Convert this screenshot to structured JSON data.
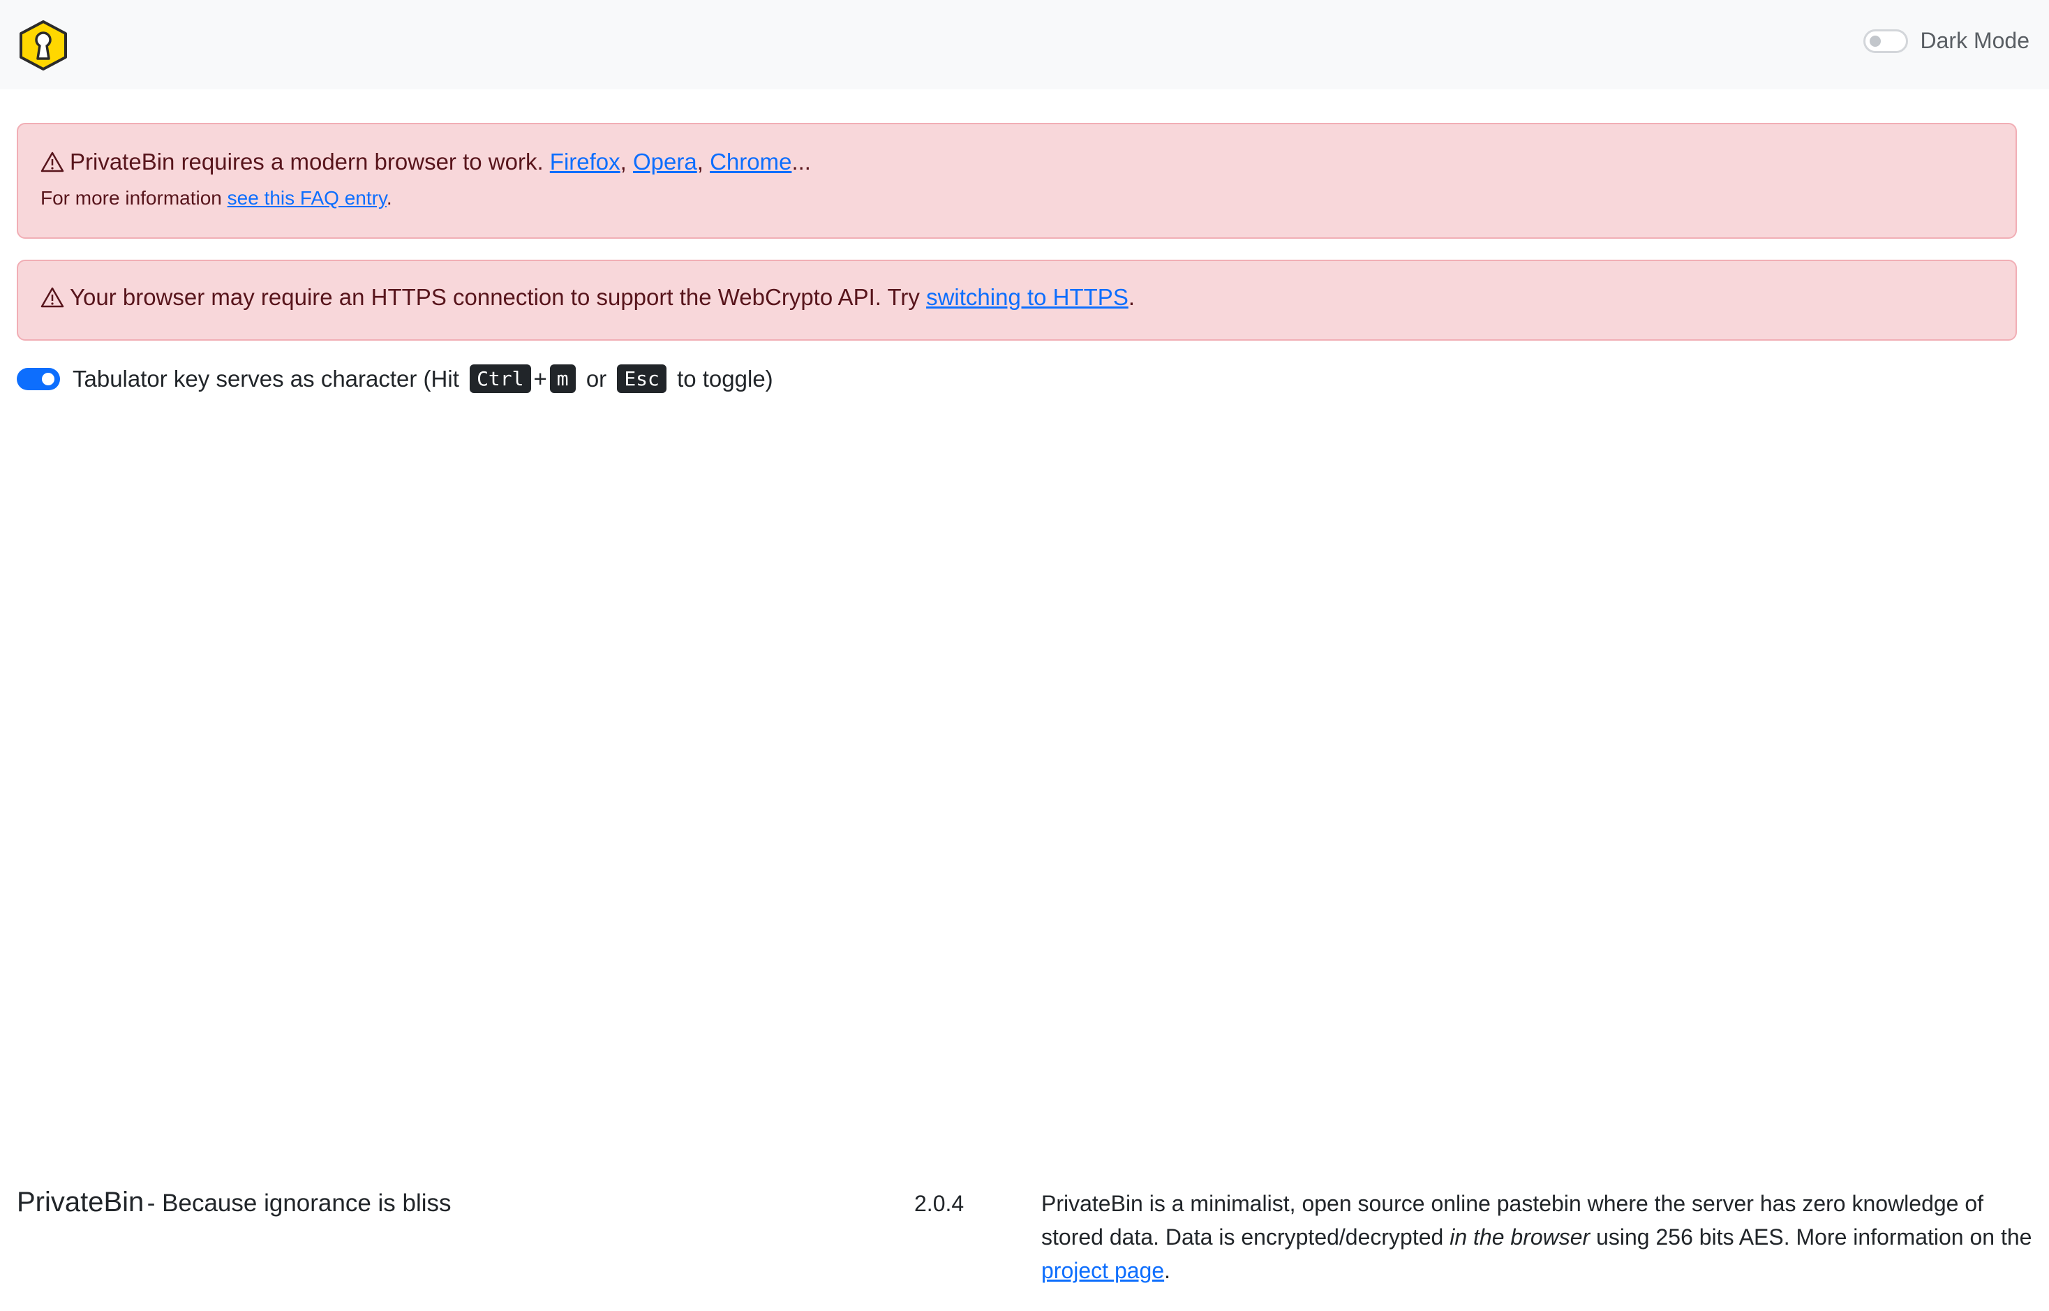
{
  "navbar": {
    "logo_icon": "keyhole-hexagon-icon",
    "dark_mode_label": "Dark Mode",
    "dark_mode_enabled": false
  },
  "alerts": {
    "modern_browser": {
      "icon": "warning-triangle-icon",
      "text": "PrivateBin requires a modern browser to work.",
      "links": [
        "Firefox",
        "Opera",
        "Chrome"
      ],
      "sep1": ",",
      "sep2": ",",
      "ellipsis": "...",
      "more_info_prefix": "For more information",
      "faq_link": "see this FAQ entry",
      "period": "."
    },
    "https": {
      "icon": "warning-triangle-icon",
      "text": "Your browser may require an HTTPS connection to support the WebCrypto API. Try",
      "link": "switching to HTTPS",
      "period": "."
    }
  },
  "tab_toggle": {
    "enabled": true,
    "prefix": "Tabulator key serves as character (Hit",
    "key1": "Ctrl",
    "plus": "+",
    "key2": "m",
    "or": "or",
    "key3": "Esc",
    "suffix": "to toggle)"
  },
  "footer": {
    "name": "PrivateBin",
    "tagline": "- Because ignorance is bliss",
    "version": "2.0.4",
    "about_part1": "PrivateBin is a minimalist, open source online pastebin where the server has zero knowledge of stored data. Data is encrypted/decrypted",
    "about_em": "in the browser",
    "about_part2": "using 256 bits AES. More information on the",
    "project_link": "project page",
    "period": "."
  },
  "colors": {
    "accent": "#0d6efd",
    "alert_bg": "#f8d7da",
    "alert_border": "#f1aeb5",
    "alert_text": "#58151c",
    "logo_yellow": "#ffd700"
  }
}
